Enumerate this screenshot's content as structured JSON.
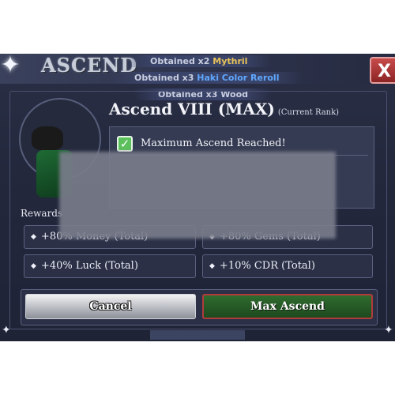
{
  "header": {
    "title": "ASCEND",
    "close_label": "X"
  },
  "notifications": [
    {
      "prefix": "Obtained x2",
      "item": "Mythril"
    },
    {
      "prefix": "Obtained x3",
      "item": "Haki Color Reroll"
    },
    {
      "prefix": "Obtained x3",
      "item": "Wood"
    }
  ],
  "rank": {
    "title": "Ascend VIII (MAX)",
    "subtitle": "(Current Rank)"
  },
  "info": {
    "check_icon": "✓",
    "message": "Maximum Ascend Reached!"
  },
  "rewards": {
    "label": "Rewards",
    "items": [
      "+80% Money (Total)",
      "+80% Gems (Total)",
      "+40% Luck (Total)",
      "+10% CDR (Total)"
    ]
  },
  "buttons": {
    "cancel": "Cancel",
    "max_ascend": "Max Ascend"
  },
  "colors": {
    "mythril": "#e8c35a",
    "haki": "#5fa8ff",
    "max_ascend_border": "#b13b3b",
    "max_ascend_fill": "#1d4a1e"
  }
}
